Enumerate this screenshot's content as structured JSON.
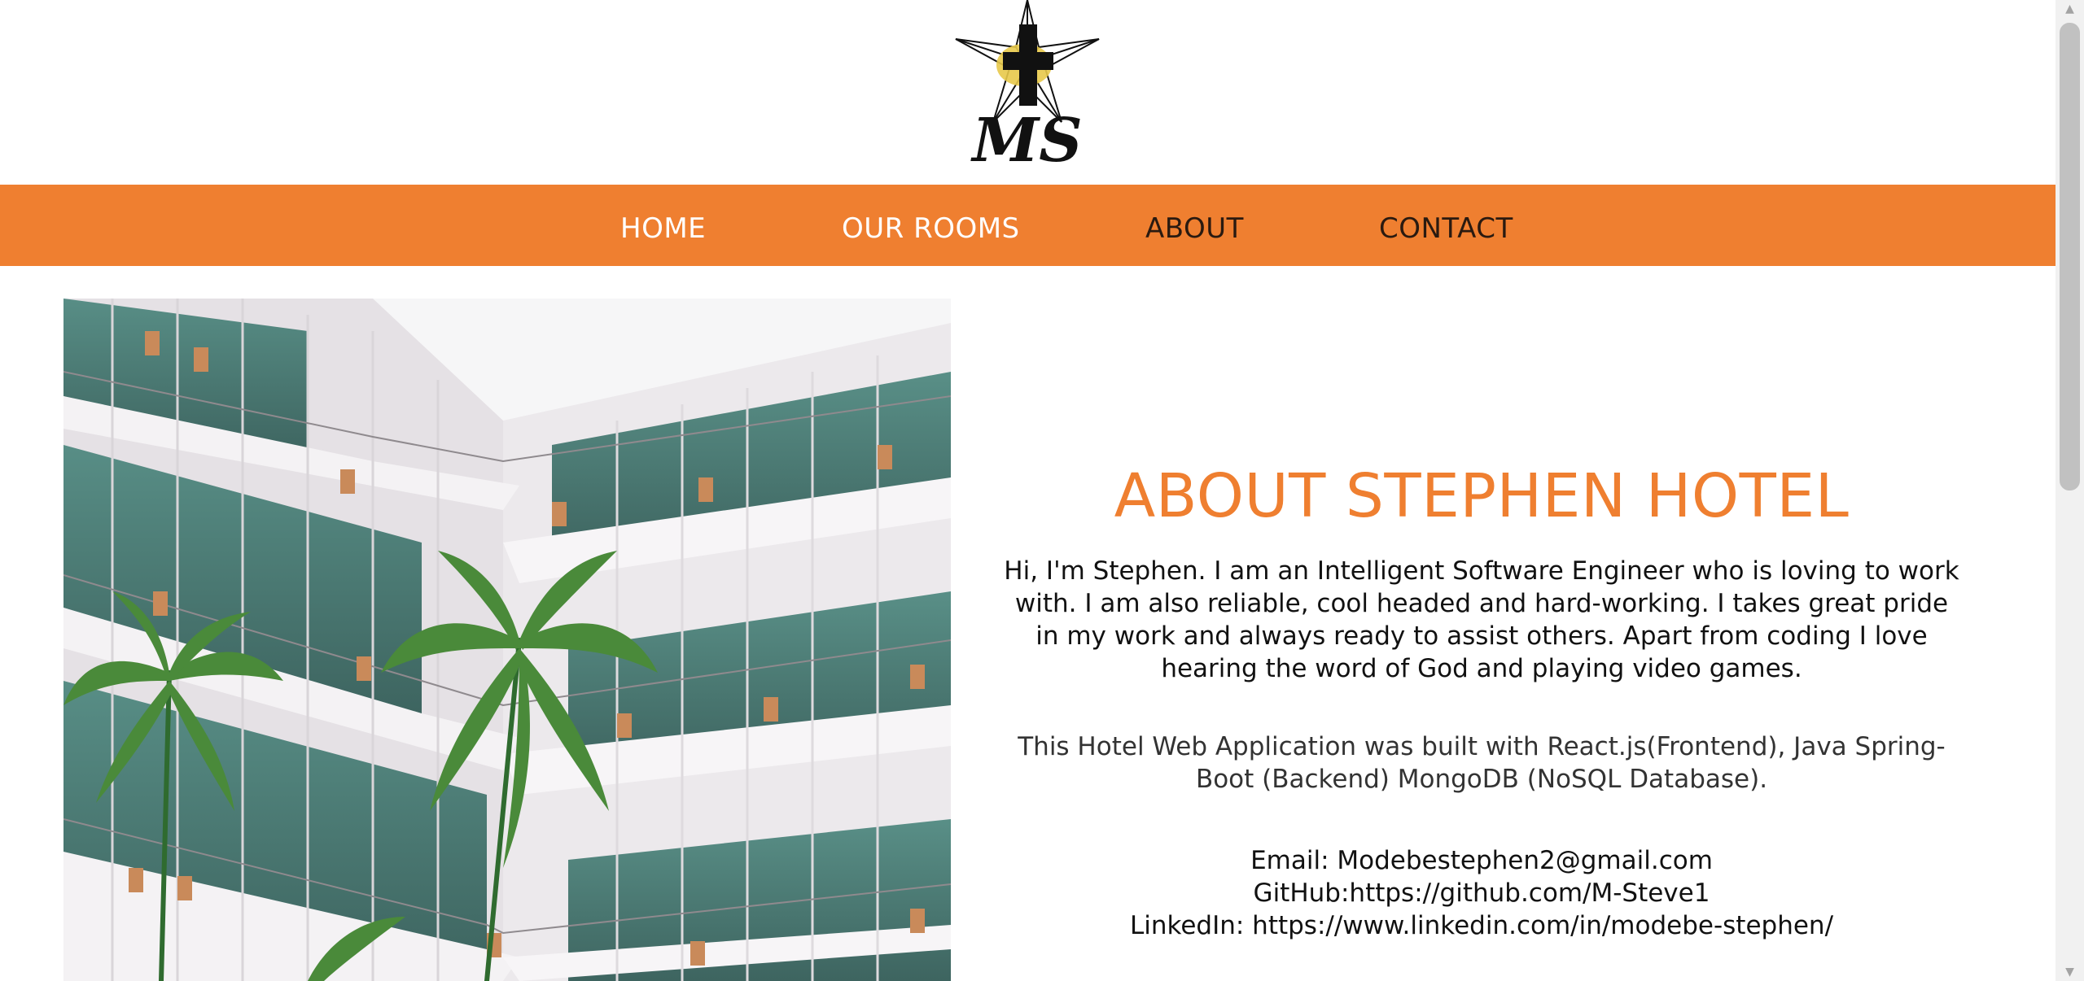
{
  "logo": {
    "text": "MS",
    "icon": "compass-cross-logo-icon"
  },
  "nav": {
    "items": [
      {
        "label": "HOME"
      },
      {
        "label": "OUR ROOMS"
      },
      {
        "label": "ABOUT"
      },
      {
        "label": "CONTACT"
      }
    ]
  },
  "about": {
    "title": "ABOUT STEPHEN HOTEL",
    "bio": "Hi, I'm Stephen. I am an Intelligent Software Engineer who is loving to work with. I am also reliable, cool headed and hard-working. I takes great pride in my work and always ready to assist others. Apart from coding I love hearing the word of God and playing video games.",
    "tech": "This Hotel Web Application was built with React.js(Frontend), Java Spring-Boot (Backend) MongoDB (NoSQL Database).",
    "email": "Email: Modebestephen2@gmail.com",
    "github": "GitHub:https://github.com/M-Steve1",
    "linkedin": "LinkedIn: https://www.linkedin.com/in/modebe-stephen/"
  },
  "colors": {
    "accent": "#ef7f30",
    "nav_active_text": "#ffffff",
    "nav_text": "#2a1a10",
    "logo_gold": "#e8c94a"
  }
}
